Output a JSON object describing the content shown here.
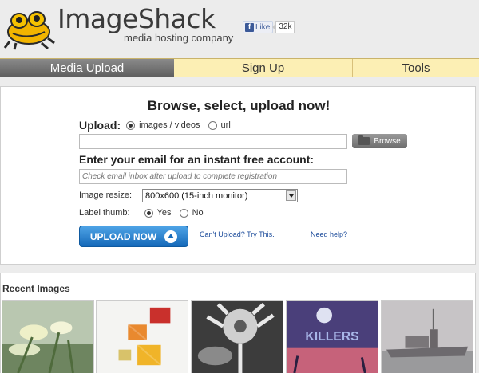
{
  "header": {
    "logo_text": "ImageShack",
    "tagline": "media hosting company",
    "fb_like_label": "Like",
    "fb_like_count": "32k"
  },
  "nav": {
    "tabs": [
      {
        "label": "Media Upload",
        "active": true
      },
      {
        "label": "Sign Up",
        "active": false
      },
      {
        "label": "Tools",
        "active": false
      }
    ]
  },
  "upload": {
    "headline": "Browse, select, upload now!",
    "upload_label": "Upload:",
    "option_images": "images / videos",
    "option_url": "url",
    "selected_option": "images / videos",
    "browse_label": "Browse",
    "email_heading": "Enter your email for an instant free account:",
    "email_placeholder": "Check email inbox after upload to complete registration",
    "resize_label": "Image resize:",
    "resize_value": "800x600 (15-inch monitor)",
    "label_thumb": "Label thumb:",
    "thumb_yes": "Yes",
    "thumb_no": "No",
    "thumb_selected": "Yes",
    "upload_button": "UPLOAD NOW",
    "cant_upload_link": "Can't Upload? Try This.",
    "need_help_link": "Need help?"
  },
  "recent": {
    "title": "Recent Images"
  },
  "colors": {
    "nav_active": "#6f6f6f",
    "nav_inactive": "#fcefb4",
    "upload_button": "#1f7fd0",
    "link": "#1a4a9a"
  }
}
